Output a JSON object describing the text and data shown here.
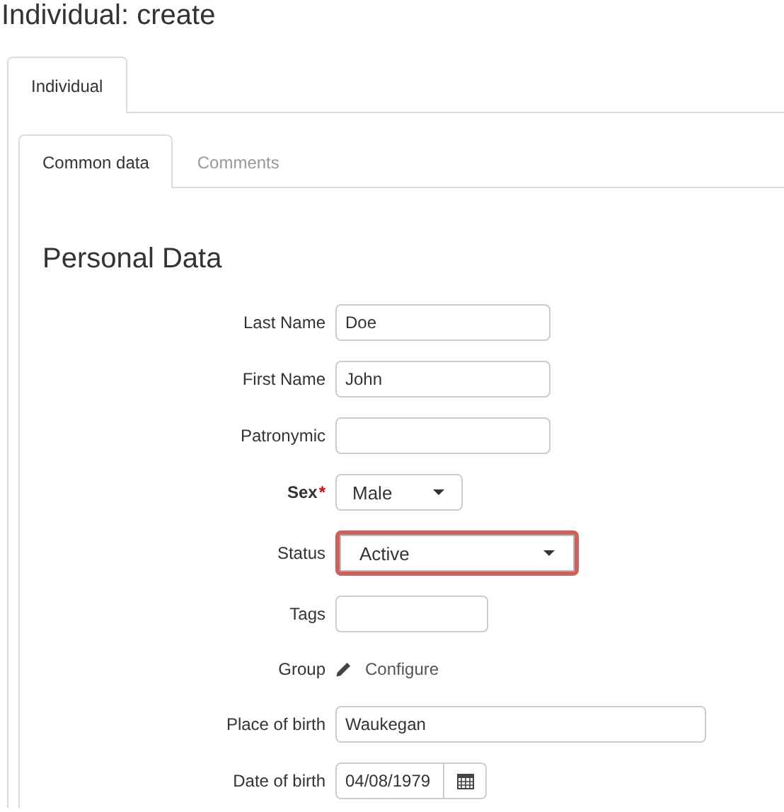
{
  "title": "Individual: create",
  "outer_tabs": [
    {
      "label": "Individual",
      "selected": true
    }
  ],
  "inner_tabs": [
    {
      "label": "Common data",
      "selected": true
    },
    {
      "label": "Comments",
      "selected": false
    }
  ],
  "section_title": "Personal Data",
  "fields": [
    {
      "kind": "text",
      "label": "Last Name",
      "value": "Doe"
    },
    {
      "kind": "text",
      "label": "First Name",
      "value": "John"
    },
    {
      "kind": "text",
      "label": "Patronymic"
    },
    {
      "kind": "select",
      "label": "Sex",
      "value": "Male",
      "required": true,
      "required_mark": "*"
    },
    {
      "kind": "select",
      "label": "Status",
      "value": "Active",
      "focused": true
    },
    {
      "kind": "text",
      "label": "Tags"
    },
    {
      "kind": "link",
      "label": "Group",
      "value": "Configure"
    },
    {
      "kind": "text",
      "label": "Place of birth",
      "value": "Waukegan"
    },
    {
      "kind": "date",
      "label": "Date of birth",
      "value": "04/08/1979"
    }
  ]
}
